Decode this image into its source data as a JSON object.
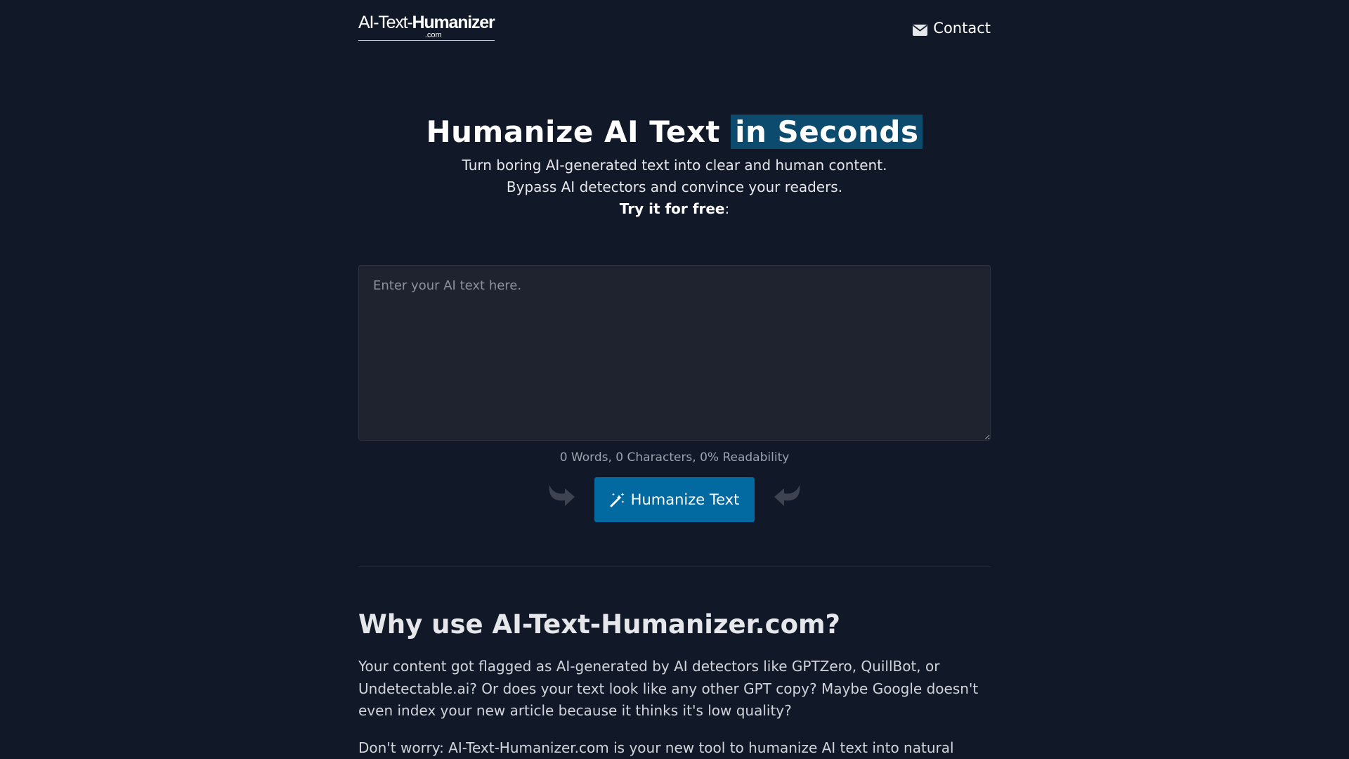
{
  "header": {
    "logo_light": "AI-Text-",
    "logo_bold": "Humanizer",
    "logo_sub": ".com",
    "contact_label": "Contact"
  },
  "hero": {
    "title_main": "Humanize AI Text",
    "title_highlight": "in Seconds",
    "subtitle": "Turn boring AI-generated text into clear and human content. Bypass AI detectors and convince your readers.",
    "cta_bold": "Try it for free",
    "cta_suffix": ":"
  },
  "editor": {
    "placeholder": "Enter your AI text here.",
    "value": ""
  },
  "stats": {
    "text": "0 Words, 0 Characters, 0% Readability"
  },
  "actions": {
    "humanize_label": "Humanize Text"
  },
  "why": {
    "title": "Why use AI-Text-Humanizer.com?",
    "paragraph1": "Your content got flagged as AI-generated by AI detectors like GPTZero, QuillBot, or Undetectable.ai? Or does your text look like any other GPT copy? Maybe Google doesn't even index your new article because it thinks it's low quality?",
    "paragraph2": "Don't worry: AI-Text-Humanizer.com is your new tool to humanize AI text into natural"
  },
  "colors": {
    "background": "#111827",
    "accent": "#0369a1",
    "highlight": "#0c4a6e",
    "editor_bg": "#1f2330"
  }
}
